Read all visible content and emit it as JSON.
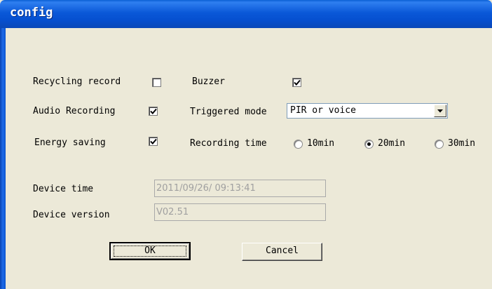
{
  "window": {
    "title": "config"
  },
  "options": {
    "recycling_record": {
      "label": "Recycling record",
      "checked": false
    },
    "buzzer": {
      "label": "Buzzer",
      "checked": true
    },
    "audio_recording": {
      "label": "Audio Recording",
      "checked": true
    },
    "energy_saving": {
      "label": "Energy saving",
      "checked": true
    }
  },
  "triggered_mode": {
    "label": "Triggered mode",
    "value": "PIR or voice"
  },
  "recording_time": {
    "label": "Recording time",
    "options": [
      "10min",
      "20min",
      "30min"
    ],
    "selected": "20min"
  },
  "device_time": {
    "label": "Device time",
    "value": "2011/09/26/ 09:13:41"
  },
  "device_version": {
    "label": "Device version",
    "value": "V02.51"
  },
  "buttons": {
    "ok": "OK",
    "cancel": "Cancel"
  }
}
